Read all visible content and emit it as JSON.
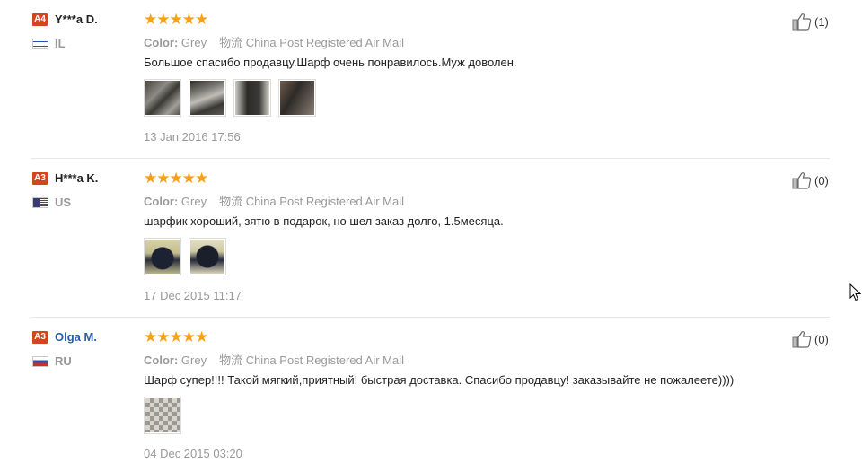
{
  "reviews": [
    {
      "level": "A4",
      "name": "Y***a D.",
      "country": "IL",
      "rating": 5,
      "stars": "★★★★★",
      "color_label": "Color:",
      "color_value": "Grey",
      "shipping": "物流 China Post Registered Air Mail",
      "text": "Большое спасибо продавцу.Шарф очень понравилось.Муж доволен.",
      "photo_count": 4,
      "date": "13 Jan 2016 17:56",
      "likes": "(1)"
    },
    {
      "level": "A3",
      "name": "H***a K.",
      "country": "US",
      "rating": 5,
      "stars": "★★★★★",
      "color_label": "Color:",
      "color_value": "Grey",
      "shipping": "物流 China Post Registered Air Mail",
      "text": "шарфик хороший, зятю в подарок, но шел заказ долго, 1.5месяца.",
      "photo_count": 2,
      "date": "17 Dec 2015 11:17",
      "likes": "(0)"
    },
    {
      "level": "A3",
      "name": "Olga M.",
      "country": "RU",
      "rating": 5,
      "stars": "★★★★★",
      "color_label": "Color:",
      "color_value": "Grey",
      "shipping": "物流 China Post Registered Air Mail",
      "text": "Шарф супер!!!! Такой мягкий,приятный! быстрая доставка. Спасибо продавцу! заказывайте не пожалеете))))",
      "photo_count": 1,
      "date": "04 Dec 2015 03:20",
      "likes": "(0)"
    }
  ],
  "colors": {
    "star": "#f7a11a",
    "level_badge": "#d0471f",
    "link_name": "#2a5aa8",
    "muted": "#999999"
  }
}
